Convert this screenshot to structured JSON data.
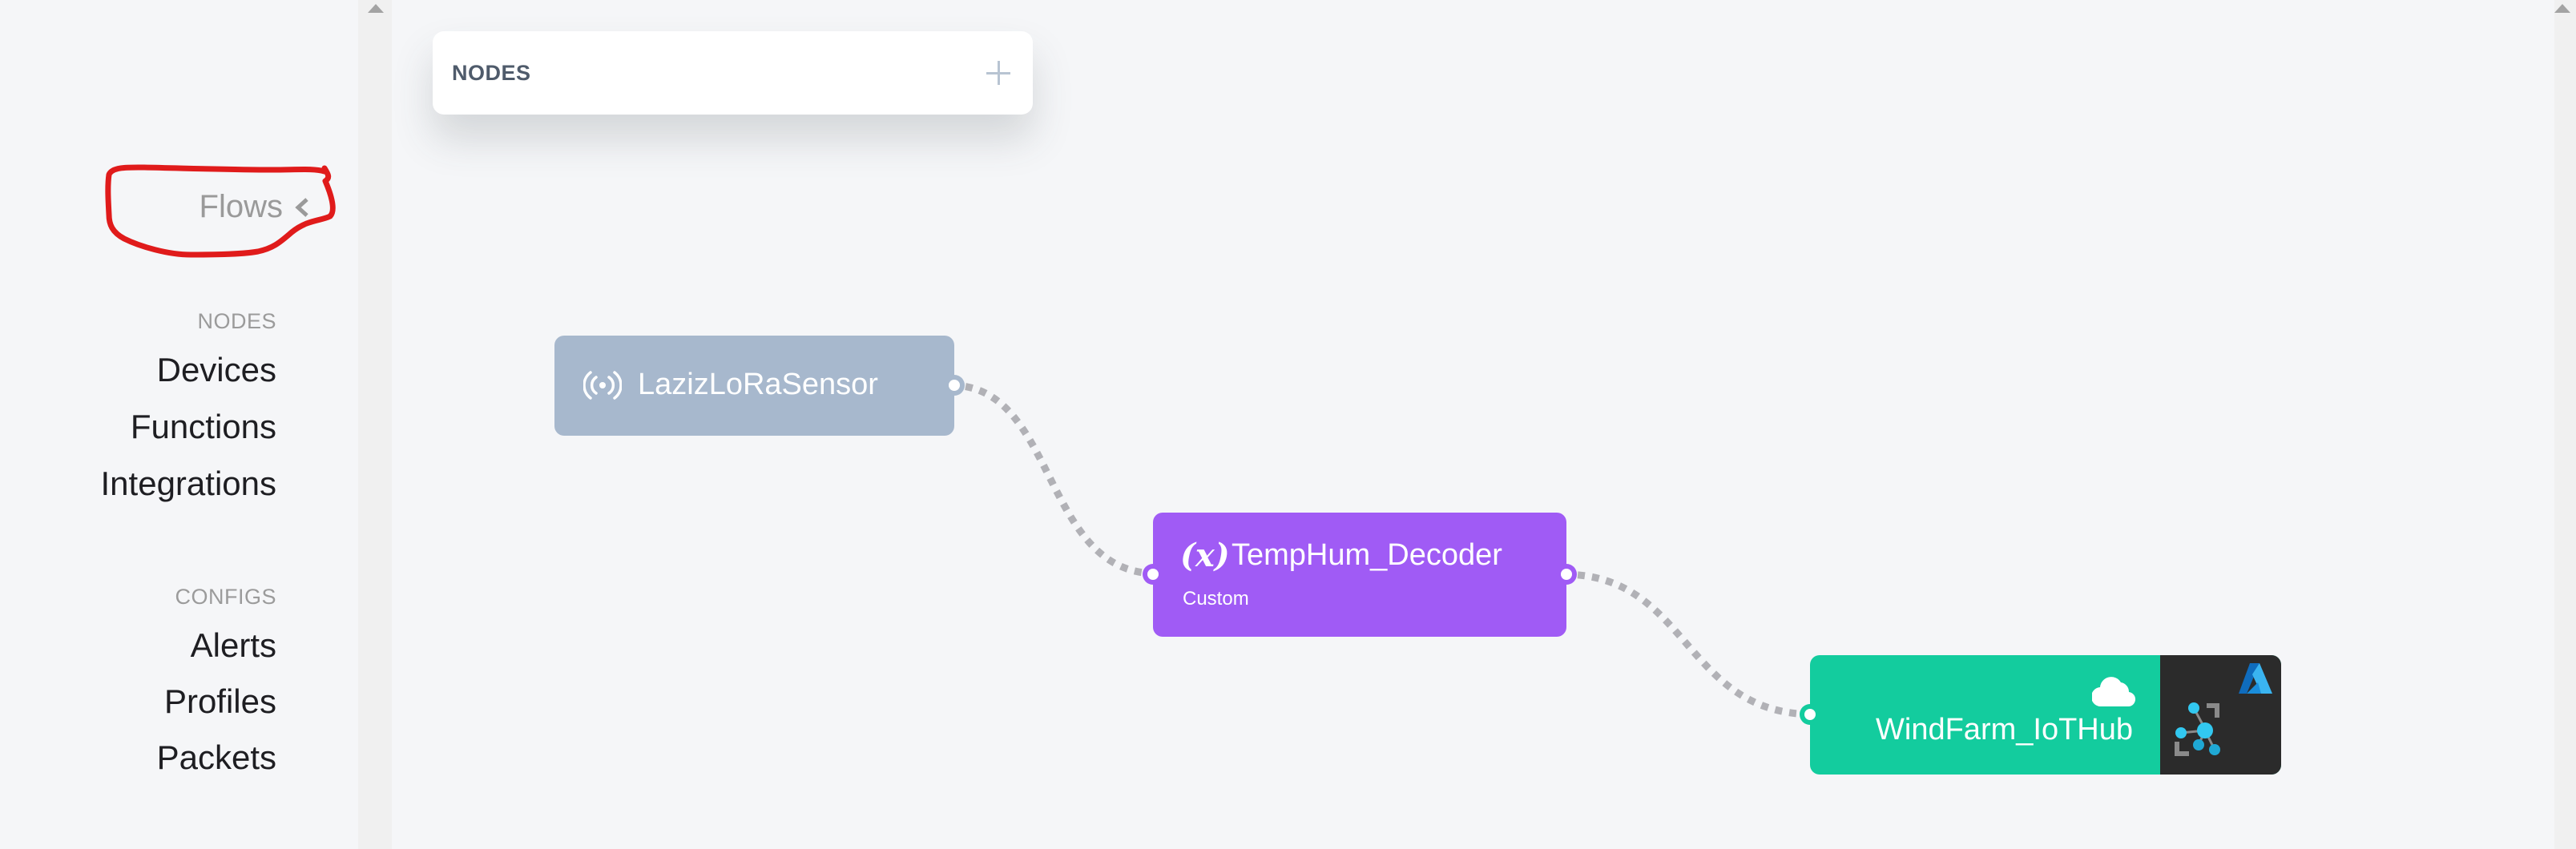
{
  "sidebar": {
    "flows_label": "Flows",
    "flows_icon": "chevron-left-icon",
    "sections": [
      {
        "label": "NODES",
        "items": [
          "Devices",
          "Functions",
          "Integrations"
        ]
      },
      {
        "label": "CONFIGS",
        "items": [
          "Alerts",
          "Profiles",
          "Packets"
        ]
      }
    ]
  },
  "nodes_panel": {
    "title": "NODES",
    "add_icon": "plus-icon"
  },
  "flow": {
    "nodes": [
      {
        "type": "device",
        "title": "LazizLoRaSensor",
        "icon": "radio-signal-icon",
        "color": "#a7b8cd"
      },
      {
        "type": "function",
        "title": "TempHum_Decoder",
        "subtitle": "Custom",
        "icon": "variable-x-icon",
        "icon_text": "(x)",
        "color": "#a05bf5"
      },
      {
        "type": "integration",
        "title": "WindFarm_IoTHub",
        "icon": "cloud-icon",
        "logo": "azure-iot-hub-logo",
        "color": "#13cc9e"
      }
    ],
    "edges": [
      {
        "from": "LazizLoRaSensor",
        "to": "TempHum_Decoder"
      },
      {
        "from": "TempHum_Decoder",
        "to": "WindFarm_IoTHub"
      }
    ],
    "edge_color": "#b1b1b6"
  },
  "annotation": {
    "color": "#e01b1b",
    "target": "Flows"
  }
}
